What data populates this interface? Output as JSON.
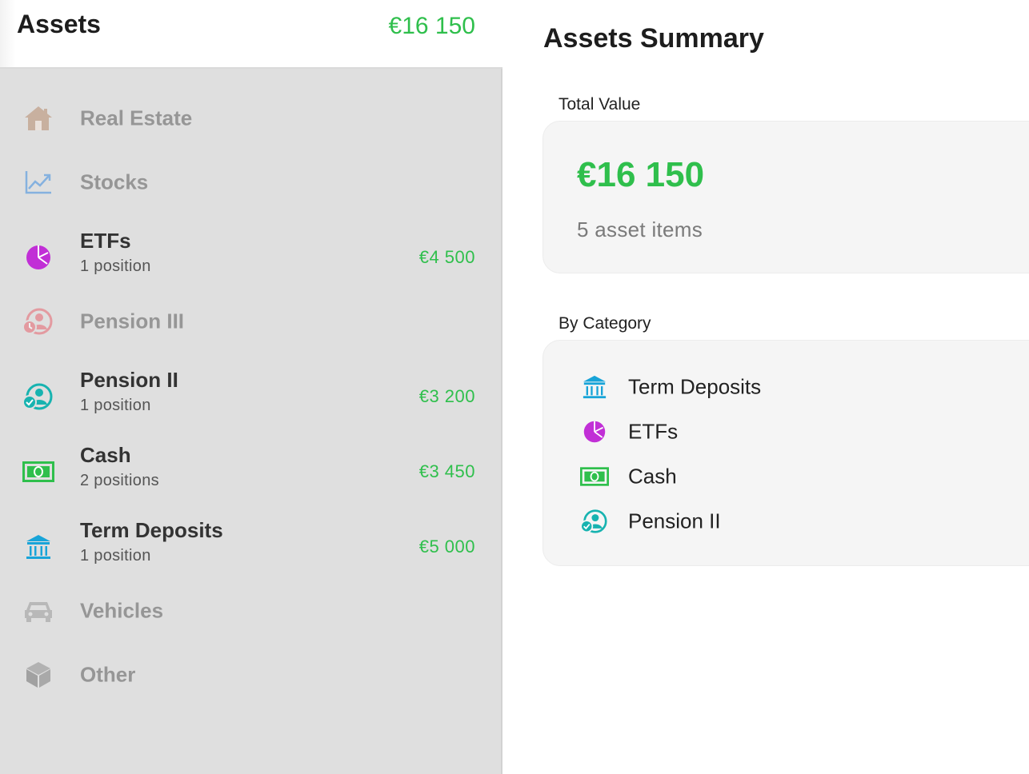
{
  "sidebar": {
    "title": "Assets",
    "total": "€16 150",
    "categories": [
      {
        "name": "Real Estate",
        "icon": "house-icon",
        "sub": "",
        "amount": ""
      },
      {
        "name": "Stocks",
        "icon": "chart-line-icon",
        "sub": "",
        "amount": ""
      },
      {
        "name": "ETFs",
        "icon": "pie-chart-icon",
        "sub": "1 position",
        "amount": "€4 500"
      },
      {
        "name": "Pension III",
        "icon": "person-clock-icon",
        "sub": "",
        "amount": ""
      },
      {
        "name": "Pension II",
        "icon": "person-check-icon",
        "sub": "1 position",
        "amount": "€3 200"
      },
      {
        "name": "Cash",
        "icon": "banknote-icon",
        "sub": "2 positions",
        "amount": "€3 450"
      },
      {
        "name": "Term Deposits",
        "icon": "bank-icon",
        "sub": "1 position",
        "amount": "€5 000"
      },
      {
        "name": "Vehicles",
        "icon": "car-icon",
        "sub": "",
        "amount": ""
      },
      {
        "name": "Other",
        "icon": "cube-icon",
        "sub": "",
        "amount": ""
      }
    ]
  },
  "main": {
    "title": "Assets Summary",
    "total_label": "Total Value",
    "total_value": "€16 150",
    "items_count": "5 asset items",
    "by_category_label": "By Category",
    "by_category": [
      {
        "label": "Term Deposits",
        "icon": "bank-icon"
      },
      {
        "label": "ETFs",
        "icon": "pie-chart-icon"
      },
      {
        "label": "Cash",
        "icon": "banknote-icon"
      },
      {
        "label": "Pension II",
        "icon": "person-check-icon"
      }
    ]
  },
  "colors": {
    "accent_green": "#2fbf4c",
    "etf_purple": "#c12fd6",
    "pension_teal": "#17b3b0",
    "pension3_pink": "#e8636d",
    "bank_blue": "#18a4d8",
    "cash_green": "#2fbf4c",
    "realestate_brown": "#b68a6b",
    "stocks_blue": "#3d8de0"
  }
}
